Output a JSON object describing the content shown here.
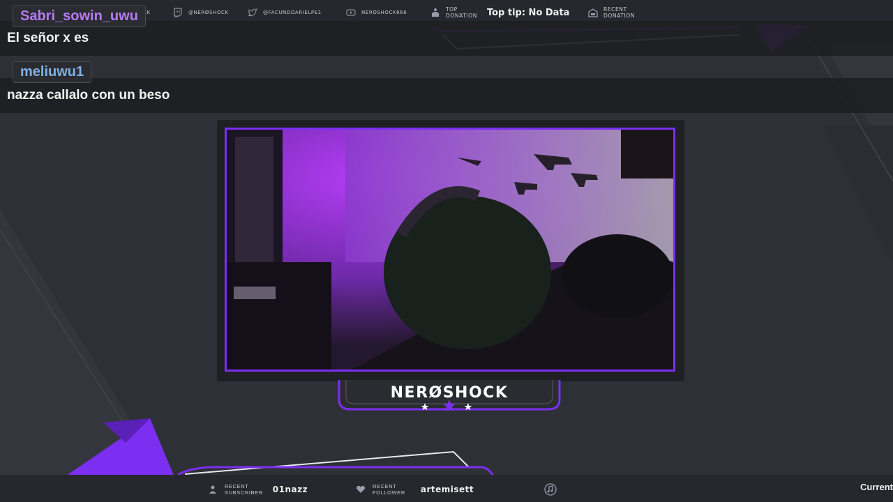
{
  "overlay": {
    "social": [
      {
        "icon": "twitch-icon",
        "label": "@NERØSHOCK"
      },
      {
        "icon": "twitter-icon",
        "label": "@FACUNDOARIELPE1"
      },
      {
        "icon": "youtube-icon",
        "label": "NEROSHOCK666"
      }
    ],
    "topbar_partial": "CK",
    "top_donation": {
      "label_line1": "TOP",
      "label_line2": "DONATION",
      "value": "Top tip: No Data"
    },
    "recent_donation": {
      "label_line1": "RECENT",
      "label_line2": "DONATION"
    },
    "streamer_name": "NERØSHOCK",
    "recent_subscriber": {
      "label_line1": "RECENT",
      "label_line2": "SUBSCRIBER",
      "value": "01nazz"
    },
    "recent_follower": {
      "label_line1": "RECENT",
      "label_line2": "FOLLOWER",
      "value": "artemisett"
    },
    "current_label": "Current",
    "accent_color": "#7b2ff0"
  },
  "chat": [
    {
      "username": "Sabri_sowin_uwu",
      "username_color": "#b77bf5",
      "message": "El señor x es"
    },
    {
      "username": "meliuwu1",
      "username_color": "#7fb2e8",
      "message": "nazza callalo con un beso"
    }
  ]
}
